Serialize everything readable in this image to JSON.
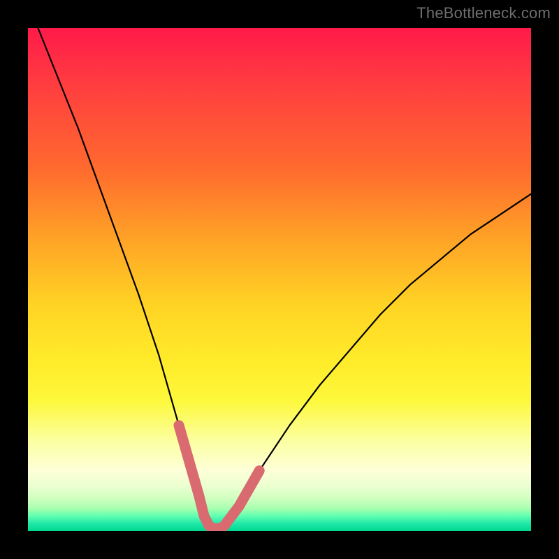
{
  "watermark": "TheBottleneck.com",
  "chart_data": {
    "type": "line",
    "title": "",
    "xlabel": "",
    "ylabel": "",
    "xlim": [
      0,
      100
    ],
    "ylim": [
      0,
      100
    ],
    "grid": false,
    "series": [
      {
        "name": "bottleneck-curve",
        "color": "#000000",
        "x": [
          2,
          6,
          10,
          14,
          18,
          22,
          26,
          30,
          32,
          34,
          35,
          36,
          37,
          38,
          39,
          42,
          46,
          52,
          58,
          64,
          70,
          76,
          82,
          88,
          94,
          100
        ],
        "values": [
          100,
          90,
          80,
          69,
          58,
          47,
          35,
          21,
          14,
          7,
          3,
          1,
          0.5,
          0.5,
          1,
          5,
          12,
          21,
          29,
          36,
          43,
          49,
          54,
          59,
          63,
          67
        ]
      },
      {
        "name": "left-highlight-segment",
        "color": "#d96a6f",
        "x": [
          30,
          32,
          34,
          35,
          36,
          37
        ],
        "values": [
          21,
          14,
          7,
          3,
          1,
          0.5
        ]
      },
      {
        "name": "right-highlight-segment",
        "color": "#d96a6f",
        "x": [
          37,
          38,
          39,
          42,
          46
        ],
        "values": [
          0.5,
          0.5,
          1,
          5,
          12
        ]
      }
    ],
    "annotations": []
  },
  "colors": {
    "curve": "#000000",
    "highlight": "#d96a6f",
    "frame_bg": "#000000"
  }
}
